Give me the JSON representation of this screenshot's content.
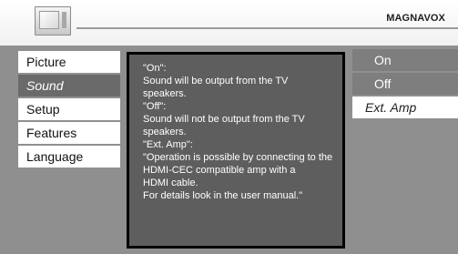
{
  "header": {
    "brand": "MAGNAVOX"
  },
  "left_menu": [
    {
      "label": "Picture",
      "active": false
    },
    {
      "label": "Sound",
      "active": true
    },
    {
      "label": "Setup",
      "active": false
    },
    {
      "label": "Features",
      "active": false
    },
    {
      "label": "Language",
      "active": false
    }
  ],
  "help_text": [
    "\"On\":",
    "Sound will be output from the TV",
    "speakers.",
    "\"Off\":",
    "Sound will not be output from the TV",
    "speakers.",
    "\"Ext. Amp\":",
    "\"Operation is possible by connecting to the",
    "HDMI-CEC compatible amp with a",
    "HDMI cable.",
    "For details look in the user manual.\""
  ],
  "options": [
    {
      "label": "On",
      "selected": false
    },
    {
      "label": "Off",
      "selected": false
    },
    {
      "label": "Ext. Amp",
      "selected": true
    }
  ]
}
